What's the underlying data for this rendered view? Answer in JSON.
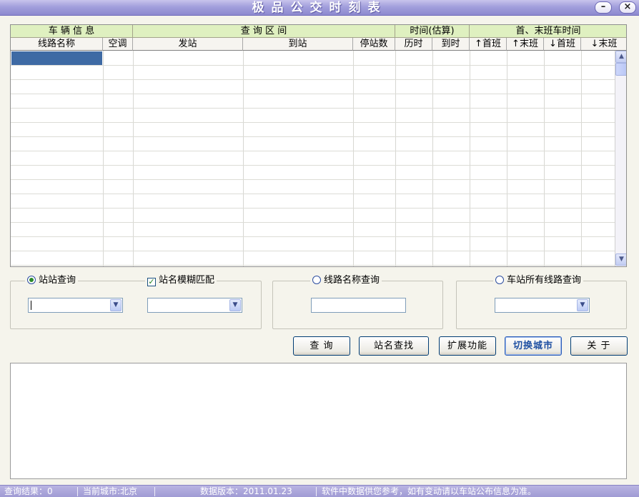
{
  "window": {
    "title": "极品公交时刻表",
    "minimize_icon": "minus-icon",
    "close_icon": "x-icon"
  },
  "grid": {
    "group_headers": [
      "车 辆 信 息",
      "查  询  区  间",
      "时间(估算)",
      "首、末班车时间"
    ],
    "columns": [
      "线路名称",
      "空调",
      "发站",
      "到站",
      "停站数",
      "历时",
      "到时",
      "↑首班",
      "↑末班",
      "↓首班",
      "↓末班"
    ],
    "rows": []
  },
  "query": {
    "station_query": {
      "label": "站站查询",
      "selected": true,
      "from_value": ""
    },
    "fuzzy_match": {
      "label": "站名模糊匹配",
      "checked": true,
      "to_value": ""
    },
    "line_name_query": {
      "label": "线路名称查询",
      "selected": false,
      "value": ""
    },
    "station_lines_query": {
      "label": "车站所有线路查询",
      "selected": false,
      "value": ""
    }
  },
  "buttons": {
    "query": "查 询",
    "find_station": "站名查找",
    "extended": "扩展功能",
    "switch_city": "切换城市",
    "about": "关 于"
  },
  "results": {
    "text": ""
  },
  "status": {
    "result": "查询结果：0",
    "city": "当前城市:北京",
    "version": "数据版本：2011.01.23",
    "notice": "软件中数据供您参考，如有变动请以车站公布信息为准。"
  }
}
